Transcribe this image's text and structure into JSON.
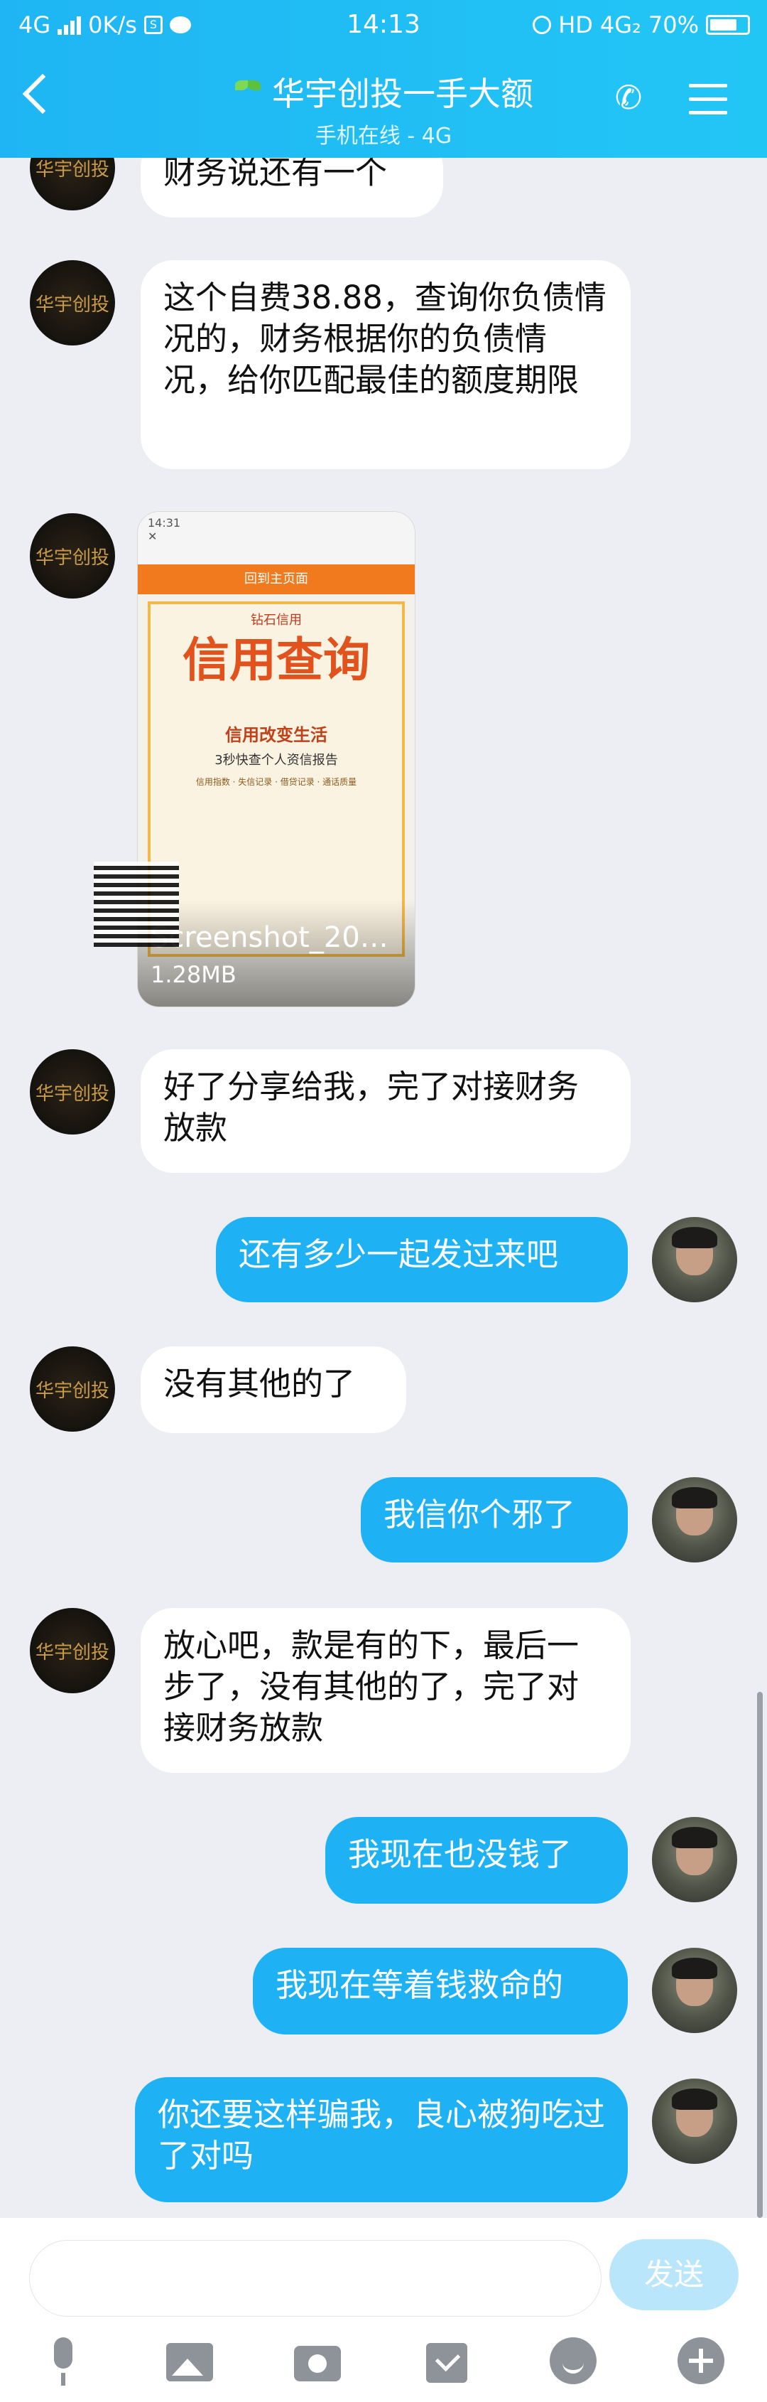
{
  "status_bar": {
    "network": "4G",
    "speed": "0K/s",
    "time": "14:13",
    "hd": "HD",
    "network2": "4G₂",
    "battery": "70%"
  },
  "header": {
    "title": "华宇创投一手大额",
    "subtitle": "手机在线 - 4G",
    "back_icon": "chevron-left-icon",
    "call_icon": "phone-icon",
    "menu_icon": "menu-icon"
  },
  "contact_avatar_text": "华宇创投",
  "messages": [
    {
      "side": "in",
      "text": "财务说还有一个"
    },
    {
      "side": "in",
      "text": "这个自费38.88，查询你负债情况的，财务根据你的负债情况，给你匹配最佳的额度期限"
    },
    {
      "side": "in",
      "type": "image",
      "file_name": "Screenshot_20…",
      "file_size": "1.28MB"
    },
    {
      "side": "in",
      "text": "好了分享给我，完了对接财务放款"
    },
    {
      "side": "out",
      "text": "还有多少一起发过来吧"
    },
    {
      "side": "in",
      "text": "没有其他的了"
    },
    {
      "side": "out",
      "text": "我信你个邪了"
    },
    {
      "side": "in",
      "text": "放心吧，款是有的下，最后一步了，没有其他的了，完了对接财务放款"
    },
    {
      "side": "out",
      "text": "我现在也没钱了"
    },
    {
      "side": "out",
      "text": "我现在等着钱救命的"
    },
    {
      "side": "out",
      "text": "你还要这样骗我，良心被狗吃过了对吗"
    }
  ],
  "shared_image": {
    "time": "14:31",
    "bar_text": "回到主页面",
    "brand": "钻石信用",
    "headline": "信用查询",
    "slogan": "信用改变生活",
    "slogan2": "3秒快查个人资信报告",
    "tags": "信用指数 · 失信记录 · 借贷记录 · 通话质量"
  },
  "input": {
    "placeholder": "",
    "send_label": "发送"
  },
  "toolbar": [
    "mic-icon",
    "image-icon",
    "camera-icon",
    "red-packet-icon",
    "emoji-icon",
    "plus-icon"
  ],
  "colors": {
    "header": "#1fb5f4",
    "outgoing_bubble": "#1eb2f5",
    "incoming_bubble": "#ffffff",
    "background": "#eceef3",
    "send_disabled": "#b9e6fb"
  }
}
